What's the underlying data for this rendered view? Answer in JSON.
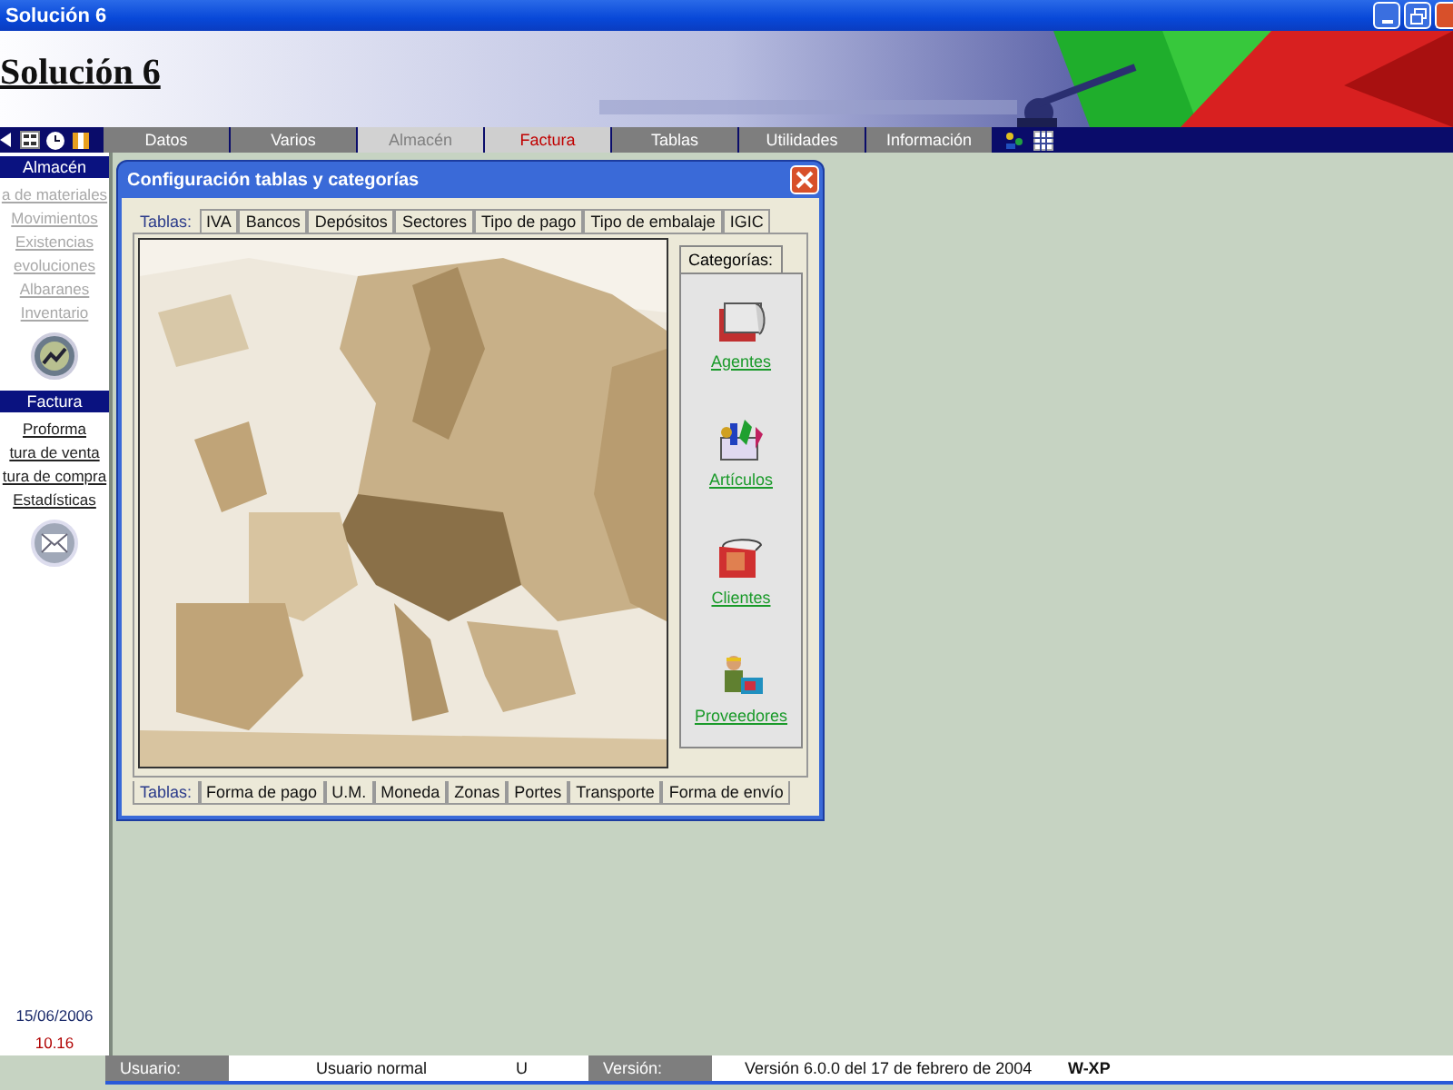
{
  "window": {
    "title": "Solución 6"
  },
  "banner": {
    "title": "Solución 6"
  },
  "menu": [
    {
      "label": "Datos",
      "selected": false,
      "disabled": false
    },
    {
      "label": "Varios",
      "selected": false,
      "disabled": false
    },
    {
      "label": "Almacén",
      "selected": false,
      "disabled": true
    },
    {
      "label": "Factura",
      "selected": true,
      "disabled": false
    },
    {
      "label": "Tablas",
      "selected": false,
      "disabled": false
    },
    {
      "label": "Utilidades",
      "selected": false,
      "disabled": false
    },
    {
      "label": "Información",
      "selected": false,
      "disabled": false
    }
  ],
  "sidebar": {
    "sections": [
      {
        "title": "Almacén",
        "items": [
          {
            "label": "a de materiales",
            "disabled": true
          },
          {
            "label": "Movimientos",
            "disabled": true
          },
          {
            "label": "Existencias",
            "disabled": true
          },
          {
            "label": "evoluciones",
            "disabled": true
          },
          {
            "label": "Albaranes",
            "disabled": true
          },
          {
            "label": "Inventario",
            "disabled": true
          }
        ]
      },
      {
        "title": "Factura",
        "items": [
          {
            "label": "Proforma",
            "disabled": false
          },
          {
            "label": "tura de venta",
            "disabled": false
          },
          {
            "label": "tura de compra",
            "disabled": false
          },
          {
            "label": "Estadísticas",
            "disabled": false
          }
        ]
      }
    ],
    "date": "15/06/2006",
    "time": "10.16"
  },
  "dialog": {
    "title": "Configuración tablas y categorías",
    "top_tabs": [
      {
        "label": "Tablas:",
        "selected": true
      },
      {
        "label": "IVA",
        "selected": false
      },
      {
        "label": "Bancos",
        "selected": false
      },
      {
        "label": "Depósitos",
        "selected": false
      },
      {
        "label": "Sectores",
        "selected": false
      },
      {
        "label": "Tipo de pago",
        "selected": false
      },
      {
        "label": "Tipo de embalaje",
        "selected": false
      },
      {
        "label": "IGIC",
        "selected": false
      }
    ],
    "categories_tab": "Categorías:",
    "categories": [
      {
        "label": "Agentes"
      },
      {
        "label": "Artículos"
      },
      {
        "label": "Clientes"
      },
      {
        "label": "Proveedores"
      }
    ],
    "bottom_tabs": [
      {
        "label": "Tablas:",
        "selected": true
      },
      {
        "label": "Forma de pago",
        "selected": false
      },
      {
        "label": "U.M.",
        "selected": false
      },
      {
        "label": "Moneda",
        "selected": false
      },
      {
        "label": "Zonas",
        "selected": false
      },
      {
        "label": "Portes",
        "selected": false
      },
      {
        "label": "Transporte",
        "selected": false
      },
      {
        "label": "Forma de envío",
        "selected": false
      }
    ]
  },
  "status_bar": {
    "user_label": "Usuario:",
    "user": "Usuario normal",
    "user_code": "U",
    "version_label": "Versión:",
    "version": "Versión 6.0.0 del 17 de febrero de 2004",
    "os": "W-XP"
  }
}
